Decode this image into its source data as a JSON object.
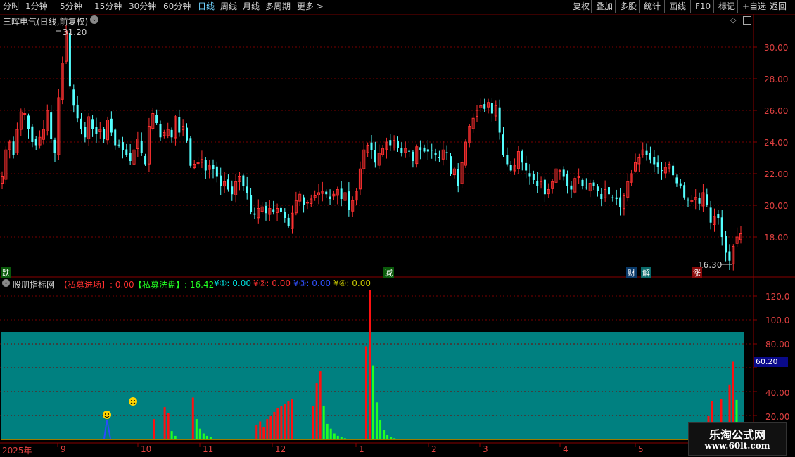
{
  "toolbar": {
    "periods": [
      "分时",
      "1分钟",
      "5分钟",
      "15分钟",
      "30分钟",
      "60分钟",
      "日线",
      "周线",
      "月线",
      "多周期",
      "更多 >"
    ],
    "actions": [
      "复权",
      "叠加",
      "多股",
      "统计",
      "画线",
      "F10",
      "标记",
      "+自选",
      "返回"
    ]
  },
  "main_chart": {
    "title": "三晖电气(日线,前复权)",
    "high_label": "31.20",
    "low_label": "16.30",
    "y_ticks": [
      "30.00",
      "28.00",
      "26.00",
      "24.00",
      "22.00",
      "20.00",
      "18.00"
    ],
    "event_tags": [
      "跌",
      "减",
      "财",
      "解",
      "涨"
    ]
  },
  "indicator": {
    "name": "股朋指标网",
    "legend": [
      {
        "text": "【私募进场】: 0.00",
        "color": "#ff3030"
      },
      {
        "text": "【私募洗盘】: 16.42",
        "color": "#22ff22"
      },
      {
        "text": "¥①: 0.00",
        "color": "#00e0e0"
      },
      {
        "text": "¥②: 0.00",
        "color": "#ff3030"
      },
      {
        "text": "¥③: 0.00",
        "color": "#3050ff"
      },
      {
        "text": "¥④: 0.00",
        "color": "#c8c800"
      }
    ],
    "y_ticks": [
      "120.0",
      "100.0",
      "80.00",
      "60.00",
      "40.00",
      "20.00"
    ],
    "current_value": "60.20"
  },
  "x_axis": {
    "labels": [
      "2025年",
      "9",
      "10",
      "11",
      "12",
      "1",
      "2",
      "3",
      "4",
      "5"
    ]
  },
  "watermark": {
    "line1": "乐淘公式网",
    "line2": "www.60lt.com"
  },
  "colors": {
    "up": "#ff3030",
    "down": "#54ffff",
    "teal": "#008080",
    "green": "#22ff22",
    "frame": "#8a0000"
  },
  "chart_data": [
    {
      "type": "candlestick",
      "title": "三晖电气(日线,前复权)",
      "ylim": [
        16,
        31.5
      ],
      "close_series_approx": [
        21.8,
        23.5,
        24.0,
        23.2,
        24.8,
        25.9,
        25.8,
        24.8,
        24.0,
        23.8,
        24.3,
        24.8,
        26.0,
        24.2,
        23.3,
        26.8,
        29.0,
        31.0,
        27.5,
        26.3,
        25.5,
        24.8,
        24.3,
        25.6,
        24.8,
        24.5,
        24.8,
        24.2,
        25.4,
        24.6,
        23.8,
        23.8,
        23.5,
        23.2,
        22.8,
        23.5,
        24.2,
        23.3,
        22.6,
        25.0,
        25.8,
        25.2,
        24.3,
        24.6,
        24.8,
        24.3,
        25.6,
        24.6,
        25.0,
        24.1,
        22.5,
        22.6,
        22.7,
        22.9,
        22.2,
        22.5,
        22.3,
        21.8,
        21.2,
        21.5,
        21.0,
        20.7,
        21.5,
        21.8,
        21.2,
        20.8,
        19.6,
        19.4,
        19.8,
        19.9,
        19.5,
        19.8,
        19.6,
        19.8,
        19.6,
        19.2,
        18.7,
        19.5,
        20.3,
        20.7,
        20.0,
        20.2,
        20.4,
        20.6,
        20.8,
        20.9,
        20.7,
        20.4,
        20.7,
        21.0,
        20.4,
        20.8,
        19.7,
        20.3,
        20.9,
        22.3,
        23.5,
        23.8,
        23.5,
        22.7,
        23.3,
        23.6,
        24.0,
        23.8,
        24.1,
        23.6,
        23.3,
        23.6,
        23.4,
        22.8,
        23.7,
        23.5,
        23.4,
        23.4,
        23.5,
        23.2,
        23.0,
        23.5,
        23.3,
        22.0,
        22.3,
        21.2,
        22.7,
        24.0,
        25.0,
        25.5,
        26.0,
        26.3,
        26.1,
        26.5,
        25.8,
        26.3,
        24.6,
        23.2,
        22.6,
        22.2,
        22.5,
        23.4,
        22.7,
        22.2,
        21.8,
        21.6,
        21.2,
        21.5,
        20.7,
        21.0,
        21.5,
        22.3,
        22.2,
        21.8,
        21.2,
        21.0,
        21.7,
        21.8,
        21.2,
        21.1,
        21.4,
        21.2,
        20.9,
        20.4,
        21.0,
        20.7,
        20.5,
        20.4,
        19.9,
        20.6,
        21.5,
        22.0,
        22.7,
        23.0,
        23.5,
        23.2,
        22.9,
        22.6,
        22.4,
        22.2,
        22.4,
        22.6,
        21.9,
        21.4,
        21.2,
        20.5,
        20.3,
        20.3,
        20.5,
        20.1,
        20.8,
        20.0,
        18.9,
        19.3,
        19.2,
        18.0,
        17.0,
        16.5,
        17.4,
        18.0,
        18.2
      ]
    },
    {
      "type": "bar",
      "title": "股朋指标网",
      "ylim": [
        0,
        130
      ],
      "series": [
        {
          "name": "【私募进场】",
          "values": [
            0,
            0,
            0,
            0,
            0,
            0,
            0,
            0,
            0,
            0,
            0,
            0,
            0,
            0,
            0,
            0,
            0,
            0,
            0,
            0,
            0,
            0,
            0,
            0,
            0,
            0,
            0,
            0,
            0,
            0,
            0,
            0,
            0,
            0,
            0,
            0,
            0,
            0,
            0,
            0,
            0,
            0,
            0,
            0,
            0,
            0,
            0,
            0,
            0,
            0,
            0,
            0,
            0,
            0,
            0,
            0,
            0,
            0,
            0,
            0,
            0,
            0,
            0,
            0,
            0,
            0,
            0,
            0,
            0,
            0,
            0,
            0,
            0,
            0,
            0,
            0,
            0,
            0,
            0,
            0,
            0,
            0,
            0,
            0,
            0,
            0,
            0,
            0,
            0,
            0,
            0,
            0,
            0,
            0,
            0,
            0,
            0,
            0,
            0,
            0,
            0,
            0,
            0,
            0,
            0,
            0,
            0,
            0,
            0,
            0,
            0,
            0,
            0,
            0,
            0,
            0,
            0,
            0,
            0,
            0,
            0,
            0,
            0,
            0,
            0,
            0,
            0,
            0,
            0,
            0,
            0,
            0,
            0,
            0,
            0,
            0,
            0,
            0,
            0,
            0,
            0,
            0,
            0,
            0,
            0,
            0,
            0,
            0,
            0,
            0,
            0,
            0,
            0,
            0,
            0,
            0,
            0,
            0,
            0,
            0,
            0,
            0,
            0,
            0,
            0,
            0,
            0,
            0,
            0,
            0,
            0,
            0,
            0,
            0,
            0,
            0,
            0,
            0,
            0,
            0,
            0,
            0,
            0,
            0,
            0,
            0,
            0,
            0,
            0,
            0,
            0,
            0,
            0,
            0,
            0,
            0,
            0,
            0,
            0,
            0,
            0,
            0
          ]
        },
        {
          "name": "【私募洗盘】",
          "values": [
            0,
            0,
            0,
            0,
            0,
            0,
            0,
            0,
            0,
            0,
            0,
            0,
            0,
            0,
            0,
            0,
            0,
            0,
            0,
            0,
            0,
            0,
            0,
            0,
            0,
            0,
            0,
            0,
            0,
            0,
            0,
            0,
            0,
            0,
            0,
            0,
            0,
            0,
            0,
            0,
            0,
            0,
            0,
            0,
            0,
            0,
            0,
            0,
            0,
            0,
            0,
            0,
            0,
            0,
            0,
            0,
            0,
            0,
            0,
            0,
            0,
            0,
            0,
            0,
            0,
            0,
            0,
            0,
            0,
            0,
            0,
            0,
            0,
            0,
            0,
            0,
            0,
            0,
            0,
            0,
            0,
            0,
            0,
            0,
            0,
            0,
            0,
            0,
            0,
            0,
            0,
            0,
            0,
            0,
            0,
            0,
            0,
            0,
            0,
            0,
            0,
            0,
            0,
            0,
            0,
            0,
            0,
            0,
            0,
            0,
            0,
            0,
            0,
            0,
            0,
            0,
            0,
            0,
            0,
            0,
            0,
            0,
            0,
            0,
            0,
            0,
            0,
            0,
            0,
            0,
            0,
            0,
            0,
            0,
            0,
            0,
            0,
            0,
            0,
            0,
            0,
            0,
            0,
            0,
            0,
            0,
            0,
            0,
            0,
            0,
            0,
            0,
            0,
            0,
            0,
            0,
            0,
            0,
            0,
            0,
            0,
            0,
            0,
            0,
            0,
            0,
            0,
            0,
            0,
            0,
            0,
            0,
            0,
            0,
            0,
            0,
            0,
            0,
            0,
            0,
            0,
            0,
            0,
            0,
            0,
            0,
            0,
            0,
            0,
            0,
            0,
            0,
            0,
            0,
            0,
            0,
            0,
            0,
            0,
            0,
            0,
            16.42
          ]
        },
        {
          "name": "red_bars",
          "values": [
            0,
            0,
            0,
            0,
            0,
            0,
            0,
            0,
            0,
            0,
            0,
            0,
            0,
            0,
            0,
            0,
            0,
            0,
            0,
            0,
            0,
            0,
            0,
            0,
            0,
            0,
            0,
            0,
            0,
            0,
            0,
            0,
            0,
            0,
            0,
            0,
            0,
            0,
            0,
            0,
            0,
            0,
            0,
            17,
            0,
            0,
            27,
            22,
            0,
            0,
            0,
            0,
            0,
            0,
            35,
            0,
            0,
            0,
            0,
            0,
            0,
            0,
            0,
            0,
            0,
            0,
            0,
            0,
            0,
            0,
            0,
            0,
            12,
            15,
            10,
            17,
            20,
            23,
            26,
            28,
            30,
            32,
            34,
            0,
            0,
            0,
            0,
            0,
            28,
            47,
            57,
            0,
            0,
            0,
            0,
            0,
            0,
            0,
            0,
            0,
            0,
            0,
            0,
            78,
            125,
            0,
            0,
            0,
            0,
            0,
            0,
            0,
            0,
            0,
            0,
            0,
            0,
            0,
            0,
            0,
            0,
            0,
            0,
            0,
            0,
            0,
            0,
            0,
            0,
            0,
            0,
            0,
            0,
            0,
            0,
            0,
            0,
            0,
            0,
            0,
            0,
            0,
            0,
            0,
            0,
            0,
            0,
            0,
            0,
            0,
            0,
            0,
            0,
            0,
            0,
            0,
            0,
            0,
            0,
            0,
            0,
            0,
            0,
            0,
            0,
            0,
            0,
            0,
            0,
            0,
            0,
            0,
            0,
            0,
            0,
            0,
            0,
            0,
            0,
            0,
            0,
            0,
            0,
            0,
            0,
            0,
            0,
            0,
            0,
            0,
            0,
            0,
            0,
            0,
            0,
            0,
            0,
            0,
            0,
            0,
            0,
            0,
            0,
            0,
            0,
            0,
            0,
            0,
            0,
            0
          ]
        },
        {
          "name": "green_bars",
          "values": [
            0,
            0,
            0,
            0,
            0,
            0,
            0,
            0,
            0,
            0,
            0,
            0,
            0,
            0,
            0,
            0,
            0,
            0,
            0,
            0,
            0,
            0,
            0,
            0,
            0,
            0,
            0,
            0,
            0,
            0,
            0,
            0,
            0,
            0,
            0,
            0,
            0,
            0,
            0,
            0,
            0,
            0,
            0,
            0,
            0,
            0,
            0,
            0,
            7,
            3,
            0,
            0,
            0,
            0,
            0,
            17,
            9,
            5,
            3,
            2,
            0,
            0,
            0,
            0,
            0,
            0,
            0,
            0,
            0,
            0,
            0,
            0,
            0,
            0,
            0,
            0,
            0,
            0,
            0,
            0,
            0,
            0,
            0,
            0,
            0,
            0,
            0,
            0,
            0,
            0,
            0,
            28,
            13,
            9,
            5,
            3,
            2,
            1,
            0,
            0,
            0,
            0,
            0,
            0,
            0,
            62,
            31,
            16,
            8,
            4,
            2,
            1,
            0,
            0,
            0,
            0,
            0,
            0,
            0,
            0,
            0,
            0,
            0,
            0,
            0,
            0,
            0,
            0,
            0,
            0,
            0,
            0,
            0,
            0,
            0,
            0,
            0,
            0,
            0,
            0,
            0,
            0,
            0,
            0,
            0,
            0,
            0,
            0,
            0,
            0,
            0,
            0,
            0,
            0,
            0,
            0,
            0,
            0,
            0,
            0,
            0,
            0,
            0,
            0,
            0,
            0,
            0,
            0,
            0,
            0,
            0,
            0,
            0,
            0,
            0,
            0,
            0,
            0,
            0,
            0,
            0,
            0,
            0,
            0,
            0,
            0,
            0,
            0,
            0,
            0,
            0,
            0,
            0,
            0,
            0,
            0,
            0,
            0,
            0,
            0,
            0,
            0,
            0,
            0,
            0,
            0
          ]
        }
      ]
    }
  ]
}
